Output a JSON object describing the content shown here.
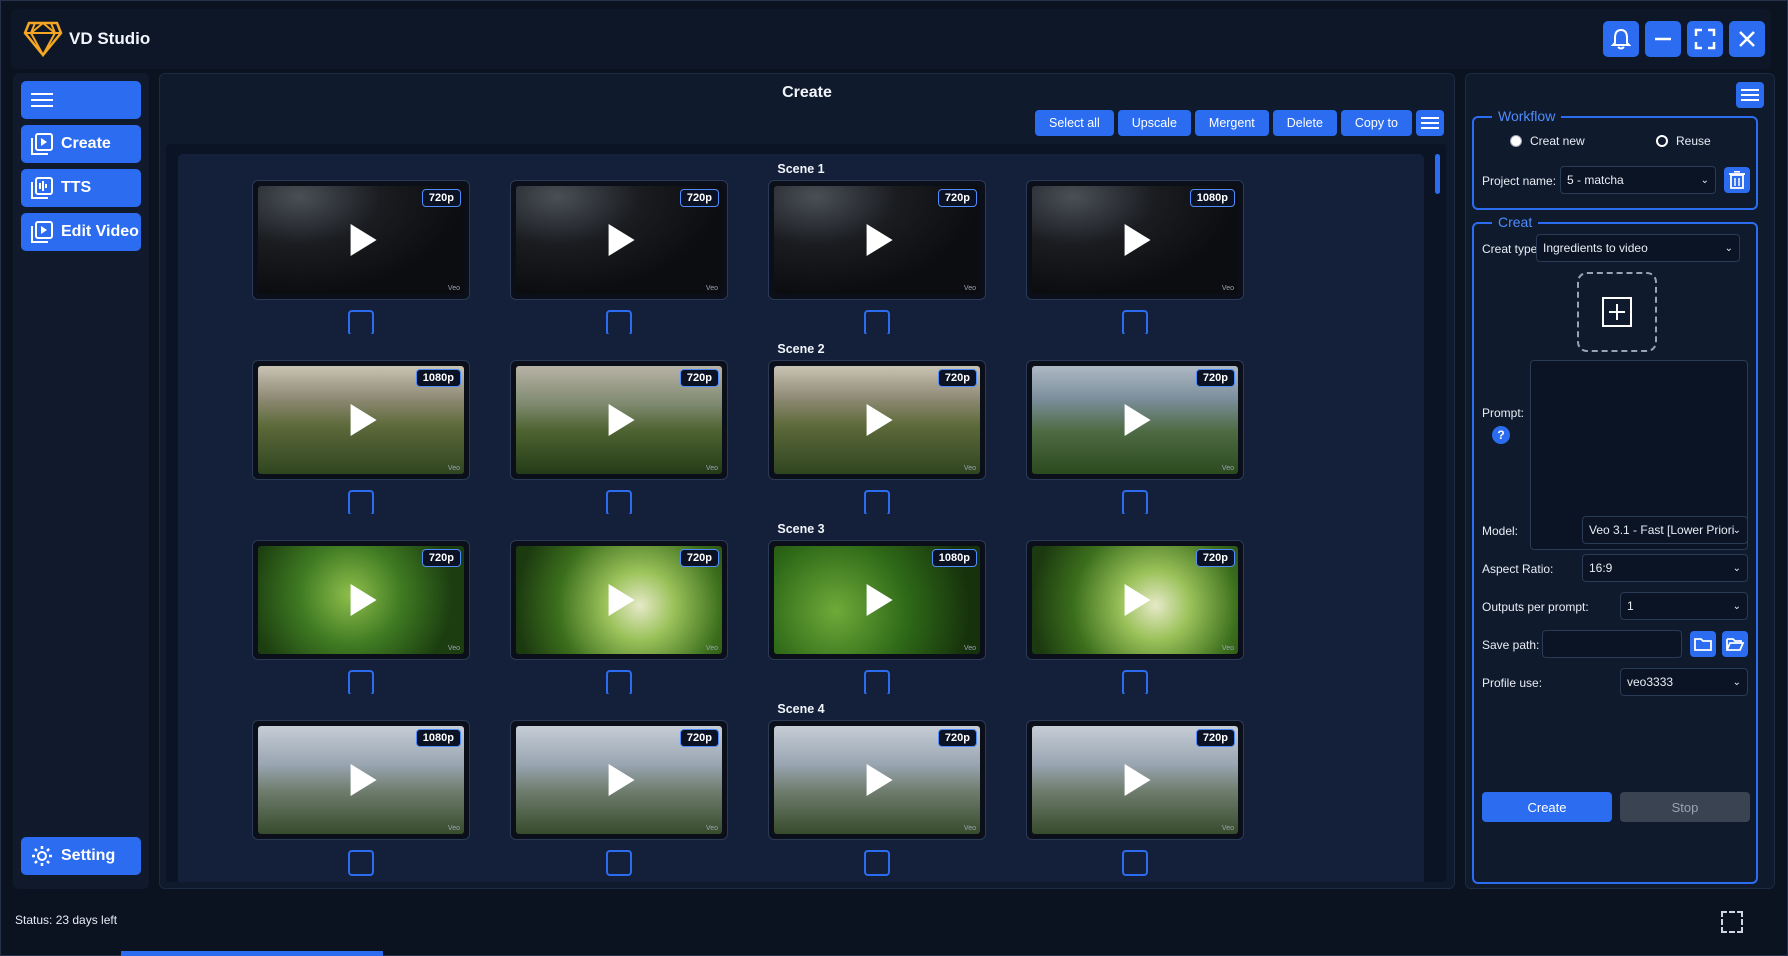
{
  "app": {
    "title": "VD Studio",
    "logo": "diamond-logo"
  },
  "window_controls": [
    "bell-icon",
    "minimize-icon",
    "fullscreen-icon",
    "close-icon"
  ],
  "sidebar": {
    "menu_icon": "hamburger-icon",
    "items": [
      {
        "label": "Create",
        "icon": "create-icon"
      },
      {
        "label": "TTS",
        "icon": "tts-icon"
      },
      {
        "label": "Edit Video",
        "icon": "edit-video-icon"
      }
    ],
    "setting": {
      "label": "Setting",
      "icon": "gear-icon"
    }
  },
  "main": {
    "title": "Create",
    "toolbar": [
      "Select all",
      "Upscale",
      "Mergent",
      "Delete",
      "Copy to"
    ],
    "scenes": [
      {
        "title": "Scene 1",
        "clips": [
          {
            "res": "720p",
            "style": "dark"
          },
          {
            "res": "720p",
            "style": "dark"
          },
          {
            "res": "720p",
            "style": "dark"
          },
          {
            "res": "1080p",
            "style": "dark"
          }
        ]
      },
      {
        "title": "Scene 2",
        "clips": [
          {
            "res": "1080p",
            "style": "field1"
          },
          {
            "res": "720p",
            "style": "field2"
          },
          {
            "res": "720p",
            "style": "field1"
          },
          {
            "res": "720p",
            "style": "field3"
          }
        ]
      },
      {
        "title": "Scene 3",
        "clips": [
          {
            "res": "720p",
            "style": "leaf1"
          },
          {
            "res": "720p",
            "style": "leaf2"
          },
          {
            "res": "1080p",
            "style": "leaf3"
          },
          {
            "res": "720p",
            "style": "leaf2"
          }
        ]
      },
      {
        "title": "Scene 4",
        "clips": [
          {
            "res": "1080p",
            "style": "mount"
          },
          {
            "res": "720p",
            "style": "mount"
          },
          {
            "res": "720p",
            "style": "mount"
          },
          {
            "res": "720p",
            "style": "mount"
          }
        ]
      }
    ],
    "watermark": "Veo"
  },
  "panel": {
    "workflow": {
      "legend": "Workflow",
      "options": [
        {
          "label": "Creat new",
          "selected": true
        },
        {
          "label": "Reuse",
          "selected": false
        }
      ],
      "project_label": "Project name:",
      "project_value": "5 - matcha"
    },
    "creat": {
      "legend": "Creat",
      "type_label": "Creat type:",
      "type_value": "Ingredients to video",
      "prompt_label": "Prompt:",
      "help": "?",
      "model_label": "Model:",
      "model_value": "Veo 3.1 - Fast [Lower Priori",
      "aspect_label": "Aspect Ratio:",
      "aspect_value": "16:9",
      "outputs_label": "Outputs per prompt:",
      "outputs_value": "1",
      "save_label": "Save path:",
      "save_value": "",
      "profile_label": "Profile use:",
      "profile_value": "veo3333",
      "create_btn": "Create",
      "stop_btn": "Stop"
    }
  },
  "status": {
    "text": "Status: 23 days left"
  },
  "colors": {
    "accent": "#2b6cf0",
    "background": "#0b1220",
    "panel": "#0f1a2c"
  }
}
